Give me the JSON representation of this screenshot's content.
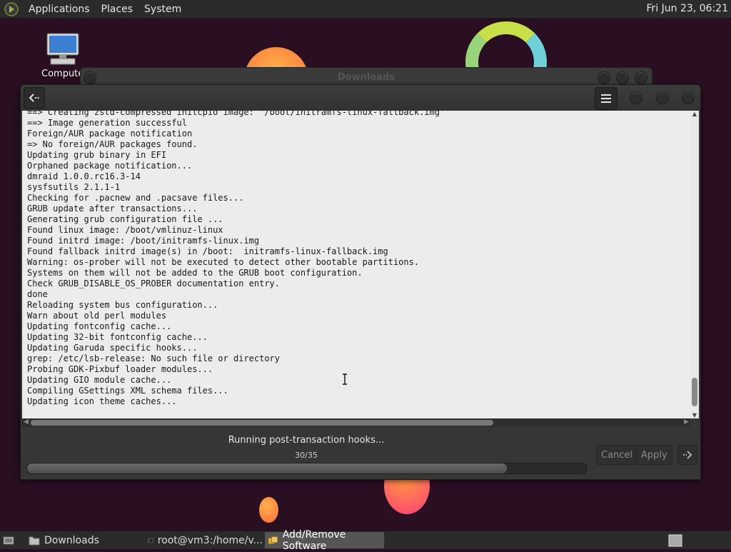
{
  "top_panel": {
    "menus": [
      "Applications",
      "Places",
      "System"
    ],
    "clock": "Fri Jun 23, 06:21"
  },
  "desktop": {
    "icons": [
      {
        "label": "Computer",
        "icon": "computer-icon"
      }
    ]
  },
  "background_window": {
    "title": "Downloads"
  },
  "main_window": {
    "terminal_lines": [
      "==> Creating zstd-compressed initcpio image: '/boot/initramfs-linux-fallback.img'",
      "==> Image generation successful",
      "Foreign/AUR package notification",
      "=> No foreign/AUR packages found.",
      "Updating grub binary in EFI",
      "Orphaned package notification...",
      "dmraid 1.0.0.rc16.3-14",
      "sysfsutils 2.1.1-1",
      "Checking for .pacnew and .pacsave files...",
      "GRUB update after transactions...",
      "Generating grub configuration file ...",
      "Found linux image: /boot/vmlinuz-linux",
      "Found initrd image: /boot/initramfs-linux.img",
      "Found fallback initrd image(s) in /boot:  initramfs-linux-fallback.img",
      "Warning: os-prober will not be executed to detect other bootable partitions.",
      "Systems on them will not be added to the GRUB boot configuration.",
      "Check GRUB_DISABLE_OS_PROBER documentation entry.",
      "done",
      "Reloading system bus configuration...",
      "Warn about old perl modules",
      "Updating fontconfig cache...",
      "Updating 32-bit fontconfig cache...",
      "Updating Garuda specific hooks...",
      "grep: /etc/lsb-release: No such file or directory",
      "Probing GDK-Pixbuf loader modules...",
      "Updating GIO module cache...",
      "Compiling GSettings XML schema files...",
      "Updating icon theme caches..."
    ],
    "status_text": "Running post-transaction hooks...",
    "progress_label": "30/35",
    "progress_fraction": 0.857,
    "cancel_label": "Cancel",
    "apply_label": "Apply"
  },
  "taskbar": {
    "tasks": [
      {
        "label": "Downloads",
        "icon": "folder-icon",
        "active": false
      },
      {
        "label": "root@vm3:/home/v...",
        "icon": "terminal-icon",
        "active": false
      },
      {
        "label": "Add/Remove Software",
        "icon": "package-icon",
        "active": true
      }
    ]
  },
  "colors": {
    "desktop_bg": "#2a0f22",
    "panel_bg": "#2b2b2b",
    "terminal_bg": "#ececec",
    "window_bg": "#363636"
  }
}
